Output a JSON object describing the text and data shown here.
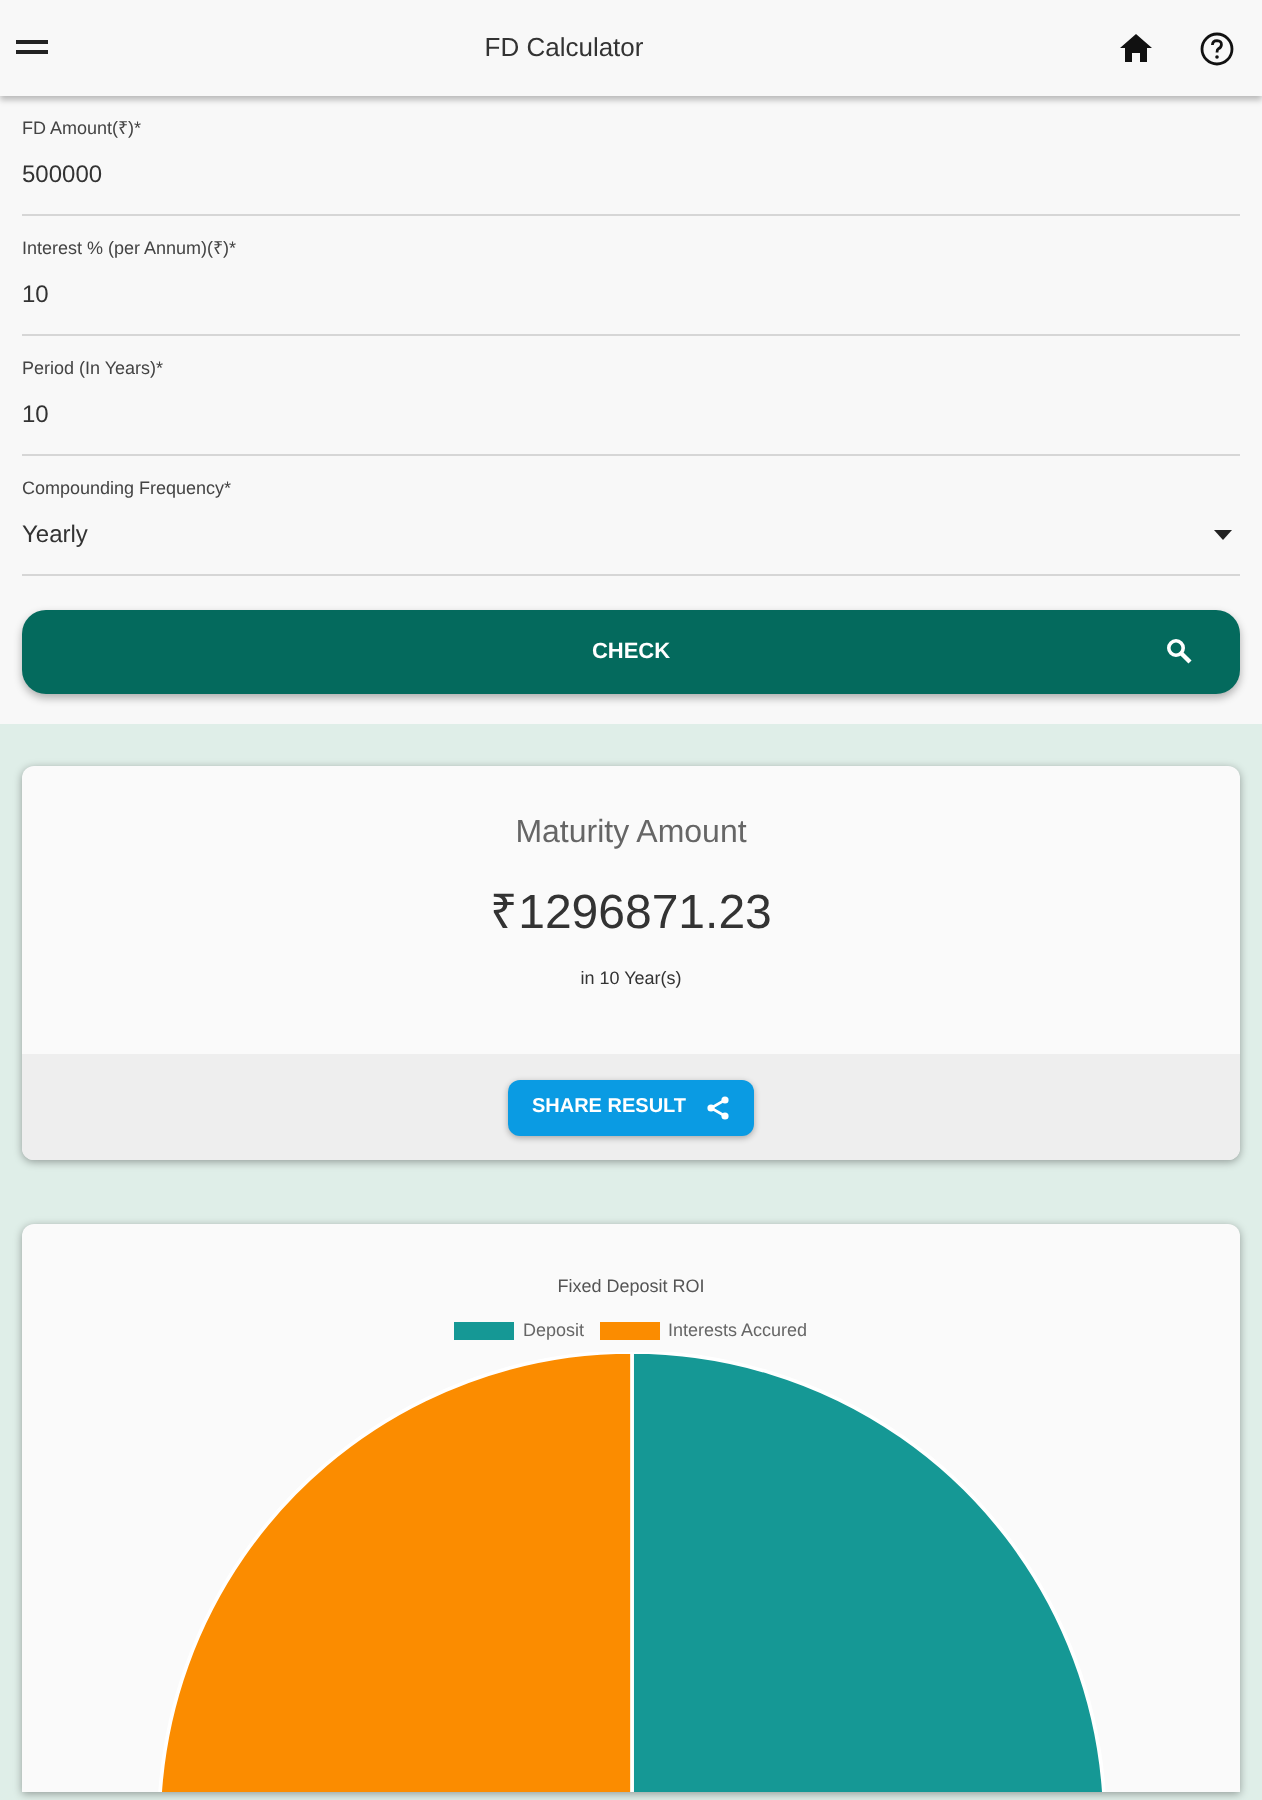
{
  "app_bar": {
    "title": "FD Calculator"
  },
  "fields": [
    {
      "kind": "text",
      "label": "FD Amount(₹)*",
      "value": "500000"
    },
    {
      "kind": "text",
      "label": "Interest % (per Annum)(₹)*",
      "value": "10"
    },
    {
      "kind": "text",
      "label": "Period (In Years)*",
      "value": "10"
    },
    {
      "kind": "select",
      "label": "Compounding Frequency*",
      "value": "Yearly"
    }
  ],
  "check_button": {
    "label": "CHECK"
  },
  "result": {
    "title": "Maturity Amount",
    "amount": "₹1296871.23",
    "period": "in 10 Year(s)",
    "share_button": "SHARE RESULT"
  },
  "chart": {
    "chart_data": {
      "type": "pie",
      "title": "Fixed Deposit ROI",
      "categories": [
        "Deposit",
        "Interests Accured"
      ],
      "values": [
        38.55,
        61.45
      ],
      "legend": "top",
      "colors": [
        "#159895",
        "#fb8c00"
      ]
    }
  }
}
